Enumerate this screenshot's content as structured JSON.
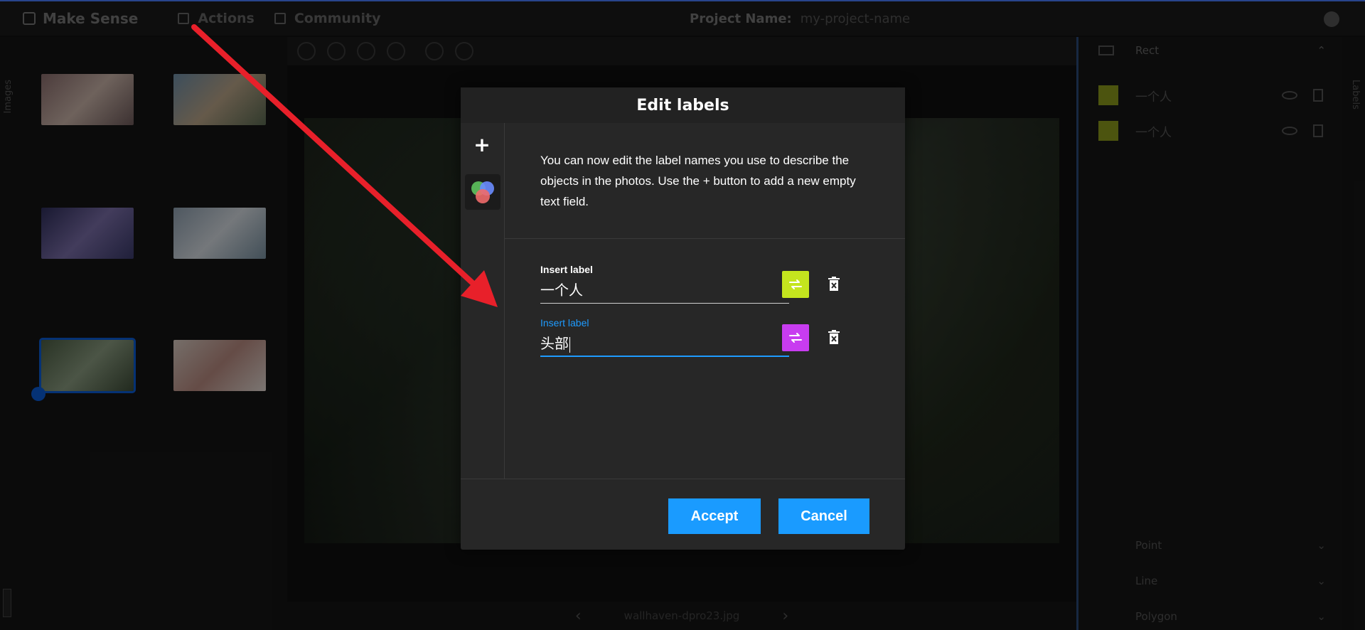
{
  "topbar": {
    "brand": "Make Sense",
    "menu": [
      {
        "label": "Actions"
      },
      {
        "label": "Community"
      }
    ],
    "project_label": "Project Name:",
    "project_name": "my-project-name"
  },
  "left_rail": {
    "label": "Images"
  },
  "right_rail": {
    "label": "Labels"
  },
  "right_panel": {
    "rect_section": "Rect",
    "labels": [
      {
        "name": "一个人",
        "color": "#8a9a1c"
      },
      {
        "name": "一个人",
        "color": "#8a9a1c"
      }
    ],
    "sections": [
      "Point",
      "Line",
      "Polygon"
    ]
  },
  "bottom_nav": {
    "filename": "wallhaven-dpro23.jpg"
  },
  "modal": {
    "title": "Edit labels",
    "plus_symbol": "+",
    "description": "You can now edit the label names you use to describe the objects in the photos. Use the + button to add a new empty text field.",
    "fields": [
      {
        "label": "Insert label",
        "value": "一个人",
        "color": "#c4e51e",
        "focused": false
      },
      {
        "label": "Insert label",
        "value": "头部",
        "color": "#c83cf0",
        "focused": true
      }
    ],
    "accept_label": "Accept",
    "cancel_label": "Cancel"
  },
  "colors": {
    "accent": "#1a9bff",
    "arrow": "#e8202a"
  }
}
